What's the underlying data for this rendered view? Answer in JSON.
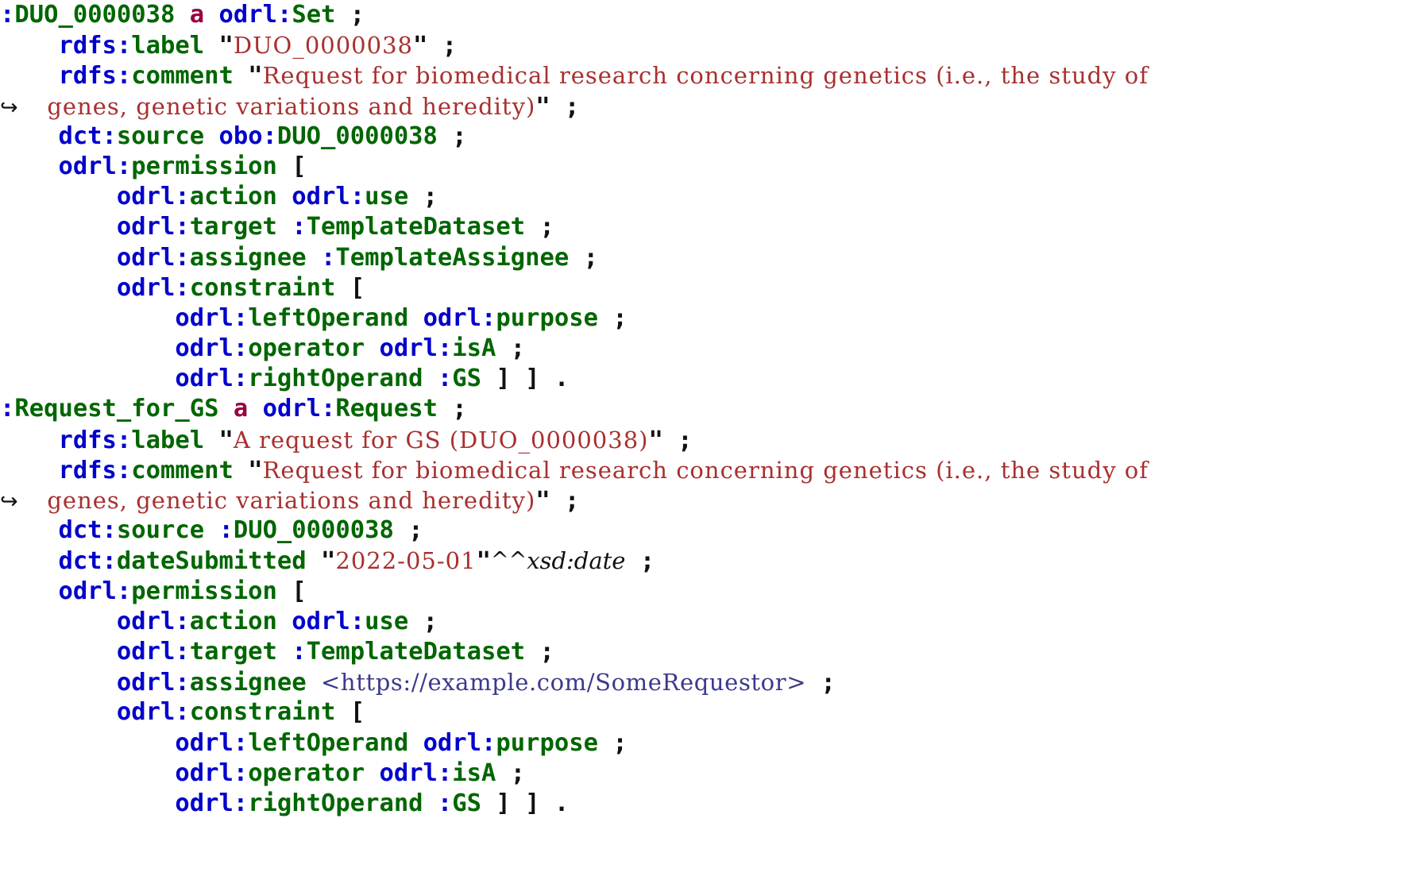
{
  "document": {
    "kind": "turtle-code-listing",
    "language": "Turtle / RDF (ODRL policy)",
    "background_color": "#ffffff",
    "colors": {
      "prefix": "#0000cc",
      "local_name": "#006600",
      "keyword_a": "#99003f",
      "string_literal": "#a8302f",
      "iri": "#3a3a8c",
      "punctuation": "#111111",
      "datatype": "#111111"
    },
    "continuation_marker": "↪"
  },
  "lines": [
    {
      "n": 1,
      "indent": "",
      "tokens": [
        {
          "t": "pfx",
          "v": ":"
        },
        {
          "t": "name",
          "v": "DUO_0000038"
        },
        {
          "t": "plain",
          "v": " "
        },
        {
          "t": "kw",
          "v": "a"
        },
        {
          "t": "plain",
          "v": " "
        },
        {
          "t": "pfx",
          "v": "odrl:"
        },
        {
          "t": "name",
          "v": "Set"
        },
        {
          "t": "plain",
          "v": " "
        },
        {
          "t": "punc",
          "v": ";"
        }
      ]
    },
    {
      "n": 2,
      "indent": "    ",
      "tokens": [
        {
          "t": "pfx",
          "v": "rdfs:"
        },
        {
          "t": "name",
          "v": "label"
        },
        {
          "t": "plain",
          "v": " "
        },
        {
          "t": "qt",
          "v": "\""
        },
        {
          "t": "str",
          "v": "DUO_0000038"
        },
        {
          "t": "qt",
          "v": "\""
        },
        {
          "t": "plain",
          "v": " "
        },
        {
          "t": "punc",
          "v": ";"
        }
      ]
    },
    {
      "n": 3,
      "indent": "    ",
      "tokens": [
        {
          "t": "pfx",
          "v": "rdfs:"
        },
        {
          "t": "name",
          "v": "comment"
        },
        {
          "t": "plain",
          "v": " "
        },
        {
          "t": "qt",
          "v": "\""
        },
        {
          "t": "str",
          "v": "Request for biomedical research concerning genetics (i.e., the study of"
        }
      ]
    },
    {
      "n": 4,
      "indent": "",
      "continuation": true,
      "tokens": [
        {
          "t": "str",
          "v": "genes, genetic variations and heredity)"
        },
        {
          "t": "qt",
          "v": "\""
        },
        {
          "t": "plain",
          "v": " "
        },
        {
          "t": "punc",
          "v": ";"
        }
      ]
    },
    {
      "n": 5,
      "indent": "    ",
      "tokens": [
        {
          "t": "pfx",
          "v": "dct:"
        },
        {
          "t": "name",
          "v": "source"
        },
        {
          "t": "plain",
          "v": " "
        },
        {
          "t": "pfx",
          "v": "obo:"
        },
        {
          "t": "name",
          "v": "DUO_0000038"
        },
        {
          "t": "plain",
          "v": " "
        },
        {
          "t": "punc",
          "v": ";"
        }
      ]
    },
    {
      "n": 6,
      "indent": "    ",
      "tokens": [
        {
          "t": "pfx",
          "v": "odrl:"
        },
        {
          "t": "name",
          "v": "permission"
        },
        {
          "t": "plain",
          "v": " "
        },
        {
          "t": "punc",
          "v": "["
        }
      ]
    },
    {
      "n": 7,
      "indent": "        ",
      "tokens": [
        {
          "t": "pfx",
          "v": "odrl:"
        },
        {
          "t": "name",
          "v": "action"
        },
        {
          "t": "plain",
          "v": " "
        },
        {
          "t": "pfx",
          "v": "odrl:"
        },
        {
          "t": "name",
          "v": "use"
        },
        {
          "t": "plain",
          "v": " "
        },
        {
          "t": "punc",
          "v": ";"
        }
      ]
    },
    {
      "n": 8,
      "indent": "        ",
      "tokens": [
        {
          "t": "pfx",
          "v": "odrl:"
        },
        {
          "t": "name",
          "v": "target"
        },
        {
          "t": "plain",
          "v": " "
        },
        {
          "t": "pfx",
          "v": ":"
        },
        {
          "t": "name",
          "v": "TemplateDataset"
        },
        {
          "t": "plain",
          "v": " "
        },
        {
          "t": "punc",
          "v": ";"
        }
      ]
    },
    {
      "n": 9,
      "indent": "        ",
      "tokens": [
        {
          "t": "pfx",
          "v": "odrl:"
        },
        {
          "t": "name",
          "v": "assignee"
        },
        {
          "t": "plain",
          "v": " "
        },
        {
          "t": "pfx",
          "v": ":"
        },
        {
          "t": "name",
          "v": "TemplateAssignee"
        },
        {
          "t": "plain",
          "v": " "
        },
        {
          "t": "punc",
          "v": ";"
        }
      ]
    },
    {
      "n": 10,
      "indent": "        ",
      "tokens": [
        {
          "t": "pfx",
          "v": "odrl:"
        },
        {
          "t": "name",
          "v": "constraint"
        },
        {
          "t": "plain",
          "v": " "
        },
        {
          "t": "punc",
          "v": "["
        }
      ]
    },
    {
      "n": 11,
      "indent": "            ",
      "tokens": [
        {
          "t": "pfx",
          "v": "odrl:"
        },
        {
          "t": "name",
          "v": "leftOperand"
        },
        {
          "t": "plain",
          "v": " "
        },
        {
          "t": "pfx",
          "v": "odrl:"
        },
        {
          "t": "name",
          "v": "purpose"
        },
        {
          "t": "plain",
          "v": " "
        },
        {
          "t": "punc",
          "v": ";"
        }
      ]
    },
    {
      "n": 12,
      "indent": "            ",
      "tokens": [
        {
          "t": "pfx",
          "v": "odrl:"
        },
        {
          "t": "name",
          "v": "operator"
        },
        {
          "t": "plain",
          "v": " "
        },
        {
          "t": "pfx",
          "v": "odrl:"
        },
        {
          "t": "name",
          "v": "isA"
        },
        {
          "t": "plain",
          "v": " "
        },
        {
          "t": "punc",
          "v": ";"
        }
      ]
    },
    {
      "n": 13,
      "indent": "            ",
      "tokens": [
        {
          "t": "pfx",
          "v": "odrl:"
        },
        {
          "t": "name",
          "v": "rightOperand"
        },
        {
          "t": "plain",
          "v": " "
        },
        {
          "t": "pfx",
          "v": ":"
        },
        {
          "t": "name",
          "v": "GS"
        },
        {
          "t": "plain",
          "v": " "
        },
        {
          "t": "punc",
          "v": "]"
        },
        {
          "t": "plain",
          "v": " "
        },
        {
          "t": "punc",
          "v": "]"
        },
        {
          "t": "plain",
          "v": " "
        },
        {
          "t": "punc",
          "v": "."
        }
      ]
    },
    {
      "n": 14,
      "indent": "",
      "tokens": [
        {
          "t": "pfx",
          "v": ":"
        },
        {
          "t": "name",
          "v": "Request_for_GS"
        },
        {
          "t": "plain",
          "v": " "
        },
        {
          "t": "kw",
          "v": "a"
        },
        {
          "t": "plain",
          "v": " "
        },
        {
          "t": "pfx",
          "v": "odrl:"
        },
        {
          "t": "name",
          "v": "Request"
        },
        {
          "t": "plain",
          "v": " "
        },
        {
          "t": "punc",
          "v": ";"
        }
      ]
    },
    {
      "n": 15,
      "indent": "    ",
      "tokens": [
        {
          "t": "pfx",
          "v": "rdfs:"
        },
        {
          "t": "name",
          "v": "label"
        },
        {
          "t": "plain",
          "v": " "
        },
        {
          "t": "qt",
          "v": "\""
        },
        {
          "t": "str",
          "v": "A request for GS (DUO_0000038)"
        },
        {
          "t": "qt",
          "v": "\""
        },
        {
          "t": "plain",
          "v": " "
        },
        {
          "t": "punc",
          "v": ";"
        }
      ]
    },
    {
      "n": 16,
      "indent": "    ",
      "tokens": [
        {
          "t": "pfx",
          "v": "rdfs:"
        },
        {
          "t": "name",
          "v": "comment"
        },
        {
          "t": "plain",
          "v": " "
        },
        {
          "t": "qt",
          "v": "\""
        },
        {
          "t": "str",
          "v": "Request for biomedical research concerning genetics (i.e., the study of"
        }
      ]
    },
    {
      "n": 17,
      "indent": "",
      "continuation": true,
      "tokens": [
        {
          "t": "str",
          "v": "genes, genetic variations and heredity)"
        },
        {
          "t": "qt",
          "v": "\""
        },
        {
          "t": "plain",
          "v": " "
        },
        {
          "t": "punc",
          "v": ";"
        }
      ]
    },
    {
      "n": 18,
      "indent": "    ",
      "tokens": [
        {
          "t": "pfx",
          "v": "dct:"
        },
        {
          "t": "name",
          "v": "source"
        },
        {
          "t": "plain",
          "v": " "
        },
        {
          "t": "pfx",
          "v": ":"
        },
        {
          "t": "name",
          "v": "DUO_0000038"
        },
        {
          "t": "plain",
          "v": " "
        },
        {
          "t": "punc",
          "v": ";"
        }
      ]
    },
    {
      "n": 19,
      "indent": "    ",
      "tokens": [
        {
          "t": "pfx",
          "v": "dct:"
        },
        {
          "t": "name",
          "v": "dateSubmitted"
        },
        {
          "t": "plain",
          "v": " "
        },
        {
          "t": "qt",
          "v": "\""
        },
        {
          "t": "str",
          "v": "2022-05-01"
        },
        {
          "t": "qt",
          "v": "\""
        },
        {
          "t": "caret",
          "v": "^^"
        },
        {
          "t": "dtype",
          "v": "xsd:date"
        },
        {
          "t": "plain",
          "v": " "
        },
        {
          "t": "punc",
          "v": ";"
        }
      ]
    },
    {
      "n": 20,
      "indent": "    ",
      "tokens": [
        {
          "t": "pfx",
          "v": "odrl:"
        },
        {
          "t": "name",
          "v": "permission"
        },
        {
          "t": "plain",
          "v": " "
        },
        {
          "t": "punc",
          "v": "["
        }
      ]
    },
    {
      "n": 21,
      "indent": "        ",
      "tokens": [
        {
          "t": "pfx",
          "v": "odrl:"
        },
        {
          "t": "name",
          "v": "action"
        },
        {
          "t": "plain",
          "v": " "
        },
        {
          "t": "pfx",
          "v": "odrl:"
        },
        {
          "t": "name",
          "v": "use"
        },
        {
          "t": "plain",
          "v": " "
        },
        {
          "t": "punc",
          "v": ";"
        }
      ]
    },
    {
      "n": 22,
      "indent": "        ",
      "tokens": [
        {
          "t": "pfx",
          "v": "odrl:"
        },
        {
          "t": "name",
          "v": "target"
        },
        {
          "t": "plain",
          "v": " "
        },
        {
          "t": "pfx",
          "v": ":"
        },
        {
          "t": "name",
          "v": "TemplateDataset"
        },
        {
          "t": "plain",
          "v": " "
        },
        {
          "t": "punc",
          "v": ";"
        }
      ]
    },
    {
      "n": 23,
      "indent": "        ",
      "tokens": [
        {
          "t": "pfx",
          "v": "odrl:"
        },
        {
          "t": "name",
          "v": "assignee"
        },
        {
          "t": "plain",
          "v": " "
        },
        {
          "t": "iri",
          "v": "<https://example.com/SomeRequestor>"
        },
        {
          "t": "plain",
          "v": " "
        },
        {
          "t": "punc",
          "v": ";"
        }
      ]
    },
    {
      "n": 24,
      "indent": "        ",
      "tokens": [
        {
          "t": "pfx",
          "v": "odrl:"
        },
        {
          "t": "name",
          "v": "constraint"
        },
        {
          "t": "plain",
          "v": " "
        },
        {
          "t": "punc",
          "v": "["
        }
      ]
    },
    {
      "n": 25,
      "indent": "            ",
      "tokens": [
        {
          "t": "pfx",
          "v": "odrl:"
        },
        {
          "t": "name",
          "v": "leftOperand"
        },
        {
          "t": "plain",
          "v": " "
        },
        {
          "t": "pfx",
          "v": "odrl:"
        },
        {
          "t": "name",
          "v": "purpose"
        },
        {
          "t": "plain",
          "v": " "
        },
        {
          "t": "punc",
          "v": ";"
        }
      ]
    },
    {
      "n": 26,
      "indent": "            ",
      "tokens": [
        {
          "t": "pfx",
          "v": "odrl:"
        },
        {
          "t": "name",
          "v": "operator"
        },
        {
          "t": "plain",
          "v": " "
        },
        {
          "t": "pfx",
          "v": "odrl:"
        },
        {
          "t": "name",
          "v": "isA"
        },
        {
          "t": "plain",
          "v": " "
        },
        {
          "t": "punc",
          "v": ";"
        }
      ]
    },
    {
      "n": 27,
      "indent": "            ",
      "tokens": [
        {
          "t": "pfx",
          "v": "odrl:"
        },
        {
          "t": "name",
          "v": "rightOperand"
        },
        {
          "t": "plain",
          "v": " "
        },
        {
          "t": "pfx",
          "v": ":"
        },
        {
          "t": "name",
          "v": "GS"
        },
        {
          "t": "plain",
          "v": " "
        },
        {
          "t": "punc",
          "v": "]"
        },
        {
          "t": "plain",
          "v": " "
        },
        {
          "t": "punc",
          "v": "]"
        },
        {
          "t": "plain",
          "v": " "
        },
        {
          "t": "punc",
          "v": "."
        }
      ]
    }
  ]
}
